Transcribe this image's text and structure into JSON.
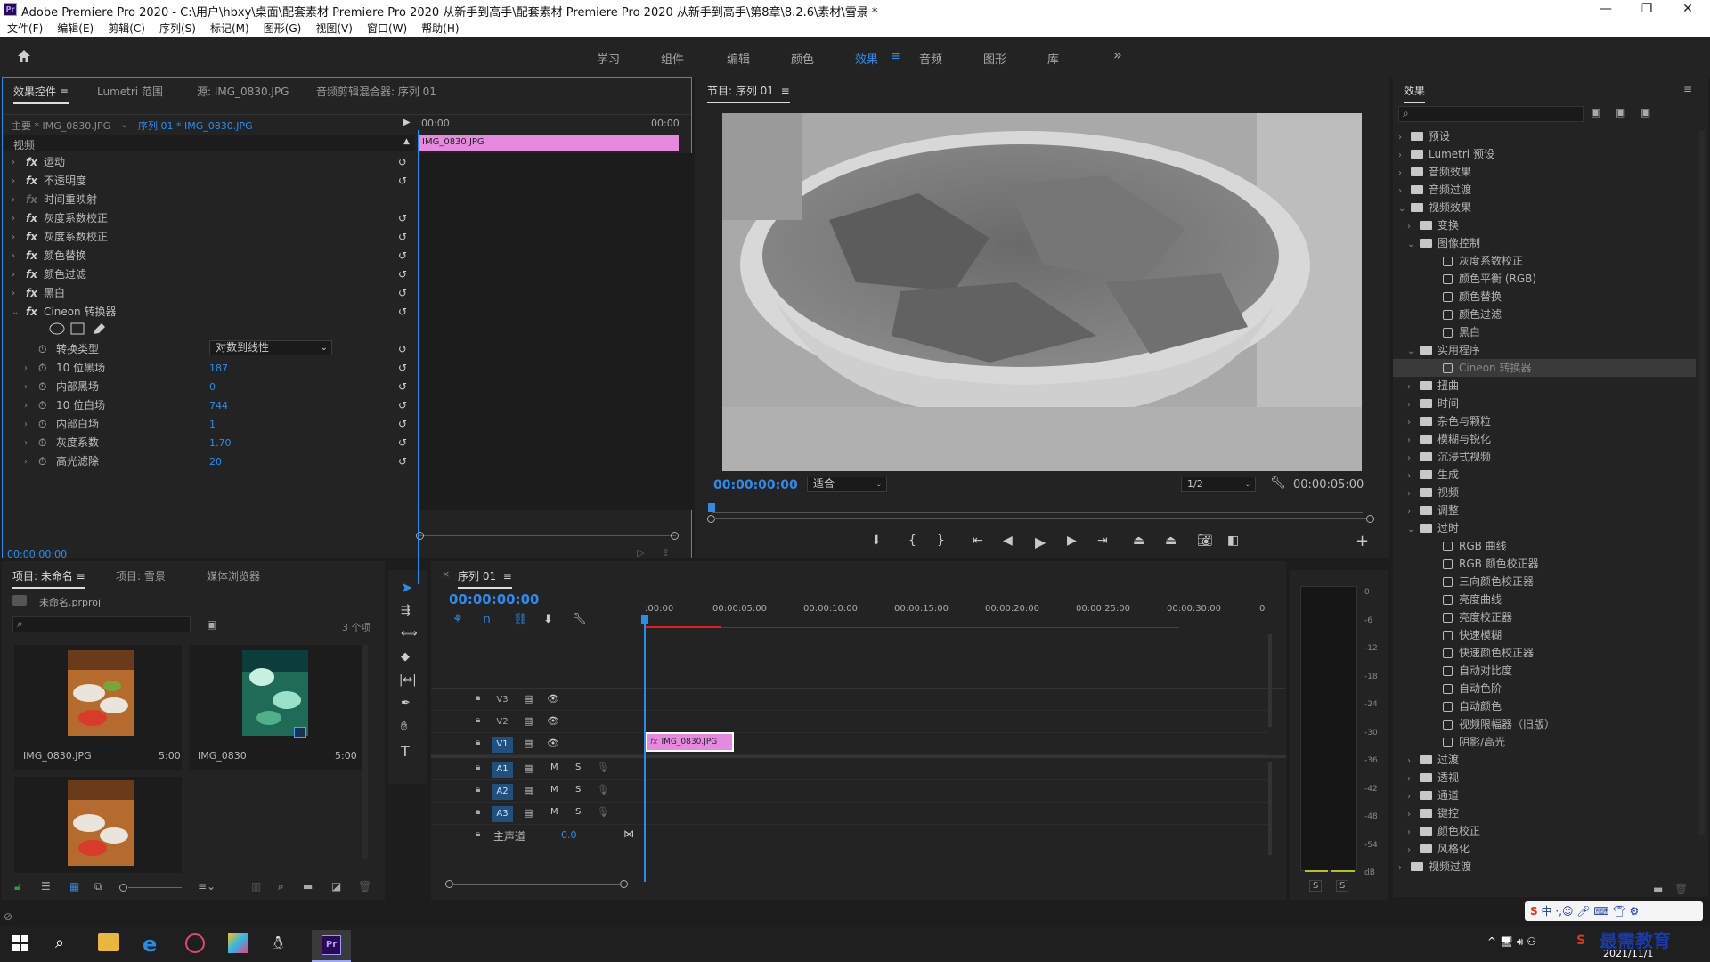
{
  "window": {
    "title": "Adobe Premiere Pro 2020 - C:\\用户\\hbxy\\桌面\\配套素材 Premiere Pro 2020 从新手到高手\\配套素材 Premiere Pro 2020 从新手到高手\\第8章\\8.2.6\\素材\\雪景 *",
    "logo": "Pr"
  },
  "menu": [
    "文件(F)",
    "编辑(E)",
    "剪辑(C)",
    "序列(S)",
    "标记(M)",
    "图形(G)",
    "视图(V)",
    "窗口(W)",
    "帮助(H)"
  ],
  "workspaces": [
    "学习",
    "组件",
    "编辑",
    "颜色",
    "效果",
    "音频",
    "图形",
    "库"
  ],
  "active_workspace": "效果",
  "more_glyph": "»",
  "fxpanel": {
    "tabs": [
      "效果控件",
      "Lumetri 范围",
      "源: IMG_0830.JPG",
      "音频剪辑混合器: 序列 01"
    ],
    "master": "主要 * IMG_0830.JPG",
    "seq": "序列 01 * IMG_0830.JPG",
    "time_start": "00:00",
    "time_end": "00:00",
    "clip": "IMG_0830.JPG",
    "section": "视频",
    "effects": [
      "运动",
      "不透明度",
      "时间重映射",
      "灰度系数校正",
      "灰度系数校正",
      "颜色替换",
      "颜色过滤",
      "黑白",
      "Cineon 转换器"
    ],
    "conversion_type_label": "转换类型",
    "conversion_type_value": "对数到线性",
    "params": [
      {
        "label": "10 位黑场",
        "value": "187"
      },
      {
        "label": "内部黑场",
        "value": "0"
      },
      {
        "label": "10 位白场",
        "value": "744"
      },
      {
        "label": "内部白场",
        "value": "1"
      },
      {
        "label": "灰度系数",
        "value": "1.70"
      },
      {
        "label": "高光滤除",
        "value": "20"
      }
    ],
    "timecode": "00:00:00:00"
  },
  "program": {
    "title": "节目: 序列 01",
    "timecode": "00:00:00:00",
    "fit": "适合",
    "quality": "1/2",
    "duration": "00:00:05:00"
  },
  "project": {
    "tabs": [
      "项目: 未命名",
      "项目: 雪景",
      "媒体浏览器"
    ],
    "file": "未命名.prproj",
    "count": "3 个项",
    "items": [
      {
        "name": "IMG_0830.JPG",
        "dur": "5:00"
      },
      {
        "name": "IMG_0830",
        "dur": "5:00"
      }
    ]
  },
  "timeline": {
    "title": "序列 01",
    "timecode": "00:00:00:00",
    "ruler": [
      ":00:00",
      "00:00:05:00",
      "00:00:10:00",
      "00:00:15:00",
      "00:00:20:00",
      "00:00:25:00",
      "00:00:30:00",
      "0"
    ],
    "video_tracks": [
      "V3",
      "V2",
      "V1"
    ],
    "audio_tracks": [
      "A1",
      "A2",
      "A3"
    ],
    "master": "主声道",
    "master_val": "0.0",
    "clip": "IMG_0830.JPG",
    "m": "M",
    "s": "S"
  },
  "meter": {
    "scale": [
      "0",
      "-6",
      "-12",
      "-18",
      "-24",
      "-30",
      "-36",
      "-42",
      "-48",
      "-54",
      "dB"
    ],
    "solo": [
      "S",
      "S"
    ]
  },
  "effects_panel": {
    "title": "效果",
    "tree": [
      {
        "l": 0,
        "t": "f",
        "c": "›",
        "n": "预设"
      },
      {
        "l": 0,
        "t": "f",
        "c": "›",
        "n": "Lumetri 预设"
      },
      {
        "l": 0,
        "t": "f",
        "c": "›",
        "n": "音频效果"
      },
      {
        "l": 0,
        "t": "f",
        "c": "›",
        "n": "音频过渡"
      },
      {
        "l": 0,
        "t": "f",
        "c": "⌄",
        "n": "视频效果"
      },
      {
        "l": 1,
        "t": "f",
        "c": "›",
        "n": "变换"
      },
      {
        "l": 1,
        "t": "f",
        "c": "⌄",
        "n": "图像控制"
      },
      {
        "l": 2,
        "t": "e",
        "n": "灰度系数校正"
      },
      {
        "l": 2,
        "t": "e",
        "n": "颜色平衡 (RGB)"
      },
      {
        "l": 2,
        "t": "e",
        "n": "颜色替换"
      },
      {
        "l": 2,
        "t": "e",
        "n": "颜色过滤"
      },
      {
        "l": 2,
        "t": "e",
        "n": "黑白"
      },
      {
        "l": 1,
        "t": "f",
        "c": "⌄",
        "n": "实用程序"
      },
      {
        "l": 2,
        "t": "e",
        "n": "Cineon 转换器",
        "sel": true
      },
      {
        "l": 1,
        "t": "f",
        "c": "›",
        "n": "扭曲"
      },
      {
        "l": 1,
        "t": "f",
        "c": "›",
        "n": "时间"
      },
      {
        "l": 1,
        "t": "f",
        "c": "›",
        "n": "杂色与颗粒"
      },
      {
        "l": 1,
        "t": "f",
        "c": "›",
        "n": "模糊与锐化"
      },
      {
        "l": 1,
        "t": "f",
        "c": "›",
        "n": "沉浸式视频"
      },
      {
        "l": 1,
        "t": "f",
        "c": "›",
        "n": "生成"
      },
      {
        "l": 1,
        "t": "f",
        "c": "›",
        "n": "视频"
      },
      {
        "l": 1,
        "t": "f",
        "c": "›",
        "n": "调整"
      },
      {
        "l": 1,
        "t": "f",
        "c": "⌄",
        "n": "过时"
      },
      {
        "l": 2,
        "t": "e",
        "n": "RGB 曲线"
      },
      {
        "l": 2,
        "t": "e",
        "n": "RGB 颜色校正器"
      },
      {
        "l": 2,
        "t": "e",
        "n": "三向颜色校正器"
      },
      {
        "l": 2,
        "t": "e",
        "n": "亮度曲线"
      },
      {
        "l": 2,
        "t": "e",
        "n": "亮度校正器"
      },
      {
        "l": 2,
        "t": "e",
        "n": "快速模糊"
      },
      {
        "l": 2,
        "t": "e",
        "n": "快速颜色校正器"
      },
      {
        "l": 2,
        "t": "e",
        "n": "自动对比度"
      },
      {
        "l": 2,
        "t": "e",
        "n": "自动色阶"
      },
      {
        "l": 2,
        "t": "e",
        "n": "自动颜色"
      },
      {
        "l": 2,
        "t": "e",
        "n": "视频限幅器（旧版）"
      },
      {
        "l": 2,
        "t": "e",
        "n": "阴影/高光"
      },
      {
        "l": 1,
        "t": "f",
        "c": "›",
        "n": "过渡"
      },
      {
        "l": 1,
        "t": "f",
        "c": "›",
        "n": "透视"
      },
      {
        "l": 1,
        "t": "f",
        "c": "›",
        "n": "通道"
      },
      {
        "l": 1,
        "t": "f",
        "c": "›",
        "n": "键控"
      },
      {
        "l": 1,
        "t": "f",
        "c": "›",
        "n": "颜色校正"
      },
      {
        "l": 1,
        "t": "f",
        "c": "›",
        "n": "风格化"
      },
      {
        "l": 0,
        "t": "f",
        "c": "›",
        "n": "视频过渡"
      }
    ]
  },
  "taskbar": {
    "date": "2021/11/1",
    "watermark": "最需教育",
    "ime": "中"
  },
  "colors": {
    "accent": "#2d8ceb",
    "clip": "#e68ae0"
  }
}
